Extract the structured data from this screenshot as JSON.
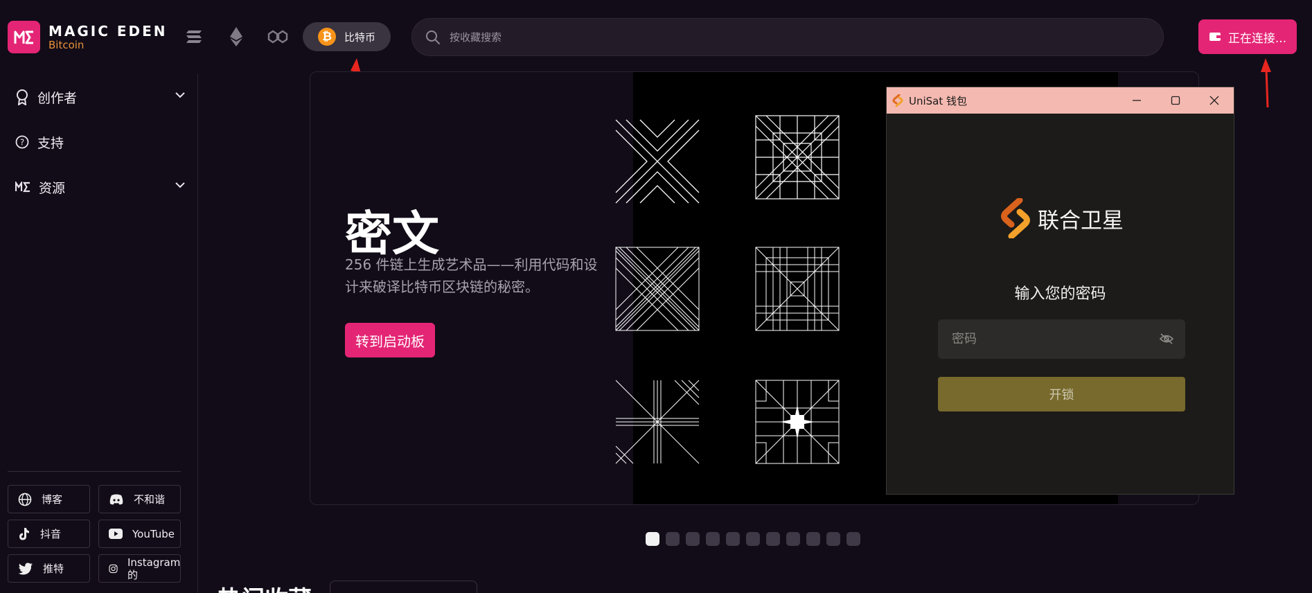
{
  "header": {
    "logo_title": "MAGIC EDEN",
    "logo_subtitle": "Bitcoin",
    "chains": [
      "solana-icon",
      "ethereum-icon",
      "polygon-icon"
    ],
    "active_chain_label": "比特币",
    "search_placeholder": "按收藏搜索",
    "connect_label": "正在连接..."
  },
  "sidebar": {
    "items": [
      {
        "label": "创作者",
        "icon": "award-icon",
        "expandable": true
      },
      {
        "label": "支持",
        "icon": "help-circle-icon",
        "expandable": false
      },
      {
        "label": "资源",
        "icon": "magic-eden-icon",
        "expandable": true
      }
    ],
    "socials": [
      {
        "label": "博客",
        "icon": "globe-icon"
      },
      {
        "label": "不和谐",
        "icon": "discord-icon"
      },
      {
        "label": "抖音",
        "icon": "tiktok-icon"
      },
      {
        "label": "YouTube",
        "icon": "youtube-icon"
      },
      {
        "label": "推特",
        "icon": "twitter-icon"
      },
      {
        "label": "Instagram 的",
        "icon": "instagram-icon"
      }
    ]
  },
  "hero": {
    "title": "密文",
    "description": "256 件链上生成艺术品——利用代码和设计来破译比特币区块链的秘密。",
    "cta_label": "转到启动板"
  },
  "carousel": {
    "count": 11,
    "active_index": 0
  },
  "bottom": {
    "heading": "热门收藏"
  },
  "wallet": {
    "window_title": "UniSat 钱包",
    "brand": "联合卫星",
    "prompt": "输入您的密码",
    "password_placeholder": "密码",
    "unlock_label": "开锁"
  },
  "colors": {
    "background": "#120c18",
    "accent": "#e42575",
    "bitcoin_orange": "#f7931a",
    "wallet_titlebar": "#f4b9b0",
    "unlock_button": "#776a2c"
  }
}
